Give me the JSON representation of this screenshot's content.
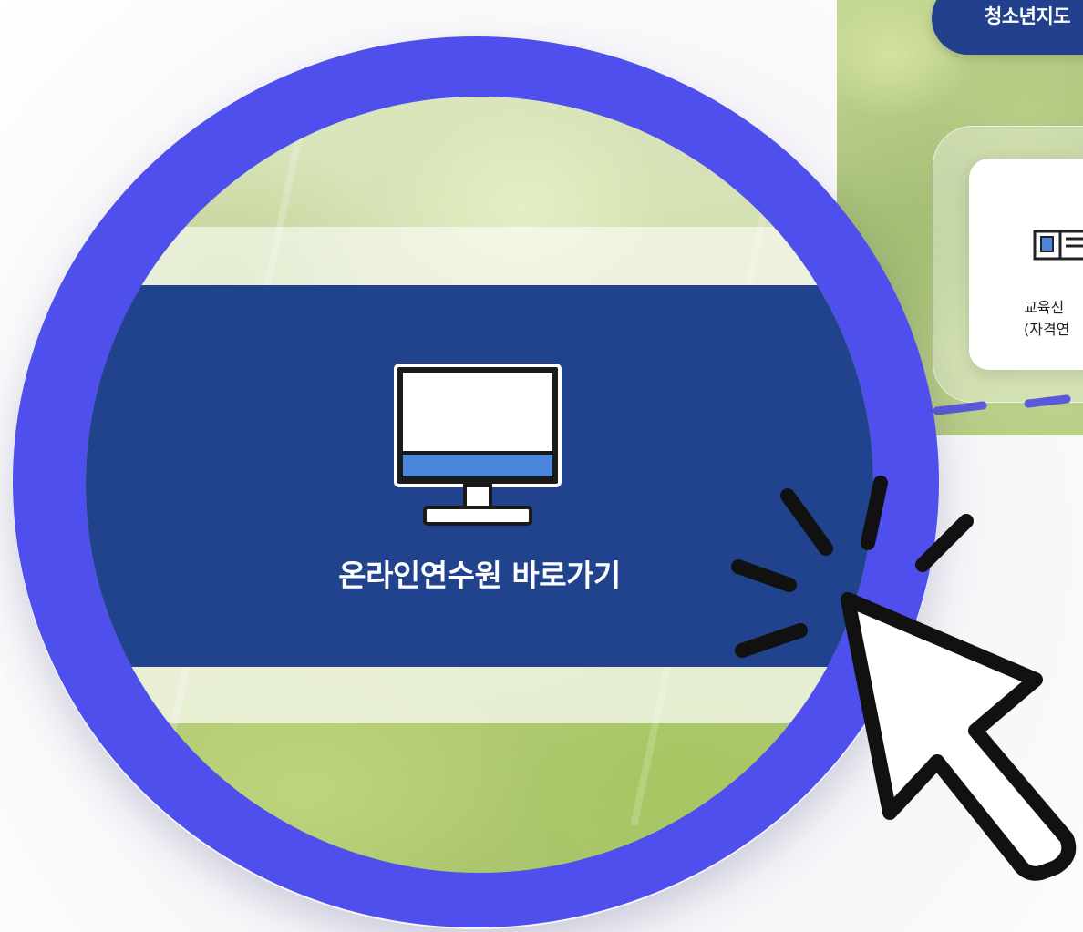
{
  "background_page": {
    "youth_button_label": "청소년지도",
    "edu_card": {
      "line1": "교육신",
      "line2": "(자격연"
    }
  },
  "magnifier": {
    "ring_color": "#4f4fee",
    "online_button": {
      "label": "온라인연수원 바로가기",
      "icon": "monitor-icon",
      "background_color": "#21428c",
      "accent_color": "#4a86dc"
    }
  },
  "cursor": {
    "icon": "pointer-arrow-click-icon"
  }
}
